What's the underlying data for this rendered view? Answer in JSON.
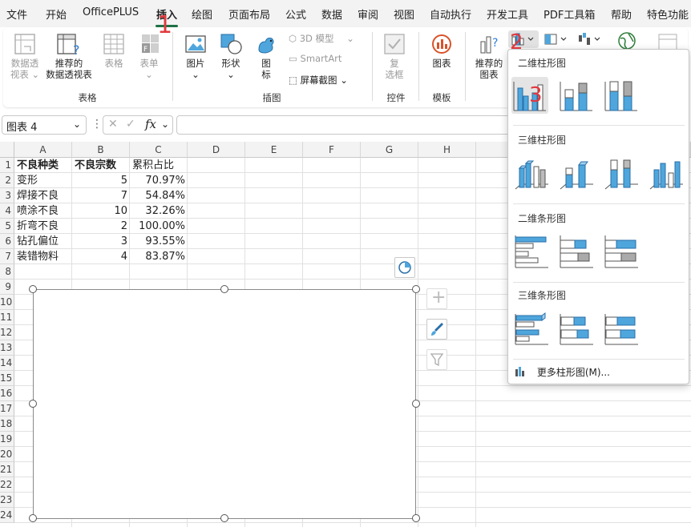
{
  "menu": {
    "items": [
      "文件",
      "开始",
      "OfficePLUS",
      "插入",
      "绘图",
      "页面布局",
      "公式",
      "数据",
      "审阅",
      "视图",
      "自动执行",
      "开发工具",
      "PDF工具箱",
      "帮助",
      "特色功能"
    ],
    "active_index": 3
  },
  "ribbon": {
    "groups": {
      "table": {
        "label": "表格",
        "pivot_line1": "数据透",
        "pivot_line2": "视表",
        "recommended_line1": "推荐的",
        "recommended_line2": "数据透视表",
        "table_btn": "表格",
        "form_btn": "表单"
      },
      "illustrations": {
        "label": "插图",
        "picture": "图片",
        "shapes": "形状",
        "icons_line1": "图",
        "icons_line2": "标",
        "model3d": "3D 模型",
        "smartart": "SmartArt",
        "screenshot": "屏幕截图"
      },
      "controls": {
        "label": "控件",
        "checkbox_line1": "复",
        "checkbox_line2": "选框"
      },
      "templates": {
        "label": "模板",
        "chart": "图表"
      },
      "charts": {
        "recommended_line1": "推荐的",
        "recommended_line2": "图表"
      }
    }
  },
  "formula_bar": {
    "name_box": "图表 4",
    "fx_label": "fx",
    "formula_value": ""
  },
  "sheet": {
    "columns": [
      "A",
      "B",
      "C",
      "D",
      "E",
      "F",
      "G",
      "H"
    ],
    "rows": [
      "1",
      "2",
      "3",
      "4",
      "5",
      "6",
      "7",
      "8",
      "9",
      "10",
      "11",
      "12",
      "13",
      "14",
      "15",
      "16",
      "17",
      "18",
      "19",
      "20",
      "21",
      "22",
      "23",
      "24"
    ],
    "headers": [
      "不良种类",
      "不良宗数",
      "累积占比"
    ],
    "data": [
      [
        "变形",
        "5",
        "70.97%"
      ],
      [
        "焊接不良",
        "7",
        "54.84%"
      ],
      [
        "喷涂不良",
        "10",
        "32.26%"
      ],
      [
        "折弯不良",
        "2",
        "100.00%"
      ],
      [
        "钻孔偏位",
        "3",
        "93.55%"
      ],
      [
        "装错物料",
        "4",
        "83.87%"
      ]
    ]
  },
  "dropdown": {
    "sections": [
      "二维柱形图",
      "三维柱形图",
      "二维条形图",
      "三维条形图"
    ],
    "more": "更多柱形图(M)..."
  },
  "annotations": [
    "1",
    "2",
    "3"
  ],
  "colors": {
    "accent_green": "#1e7145",
    "chart_blue": "#4ea6dc",
    "chart_gray": "#a5a5a5",
    "annotation_red": "#e0393e"
  }
}
